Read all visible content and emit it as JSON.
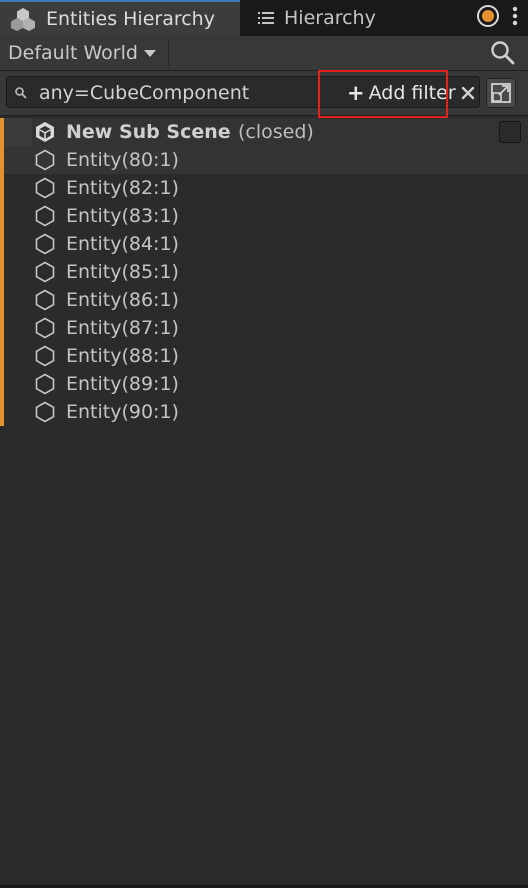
{
  "tabs": {
    "entities_label": "Entities Hierarchy",
    "hierarchy_label": "Hierarchy"
  },
  "toolbar": {
    "world_label": "Default World"
  },
  "search": {
    "query": "any=CubeComponent",
    "add_filter_label": "Add filter",
    "add_filter_plus": "+"
  },
  "scene": {
    "name": "New Sub Scene",
    "status": "(closed)"
  },
  "entities": [
    "Entity(80:1)",
    "Entity(82:1)",
    "Entity(83:1)",
    "Entity(84:1)",
    "Entity(85:1)",
    "Entity(86:1)",
    "Entity(87:1)",
    "Entity(88:1)",
    "Entity(89:1)",
    "Entity(90:1)"
  ],
  "colors": {
    "accent_bar": "#e2922e",
    "highlight_box": "#e0241c",
    "active_tab_line": "#3a79bb",
    "lock_icon": "#e2922e"
  },
  "icons": {
    "tab_entities": "entities-cubes-icon",
    "tab_hierarchy": "list-icon",
    "search": "magnifier-icon",
    "clear": "close-icon",
    "popout": "popout-window-icon",
    "scene": "unity-cube-icon",
    "entity": "hexagon-icon"
  }
}
